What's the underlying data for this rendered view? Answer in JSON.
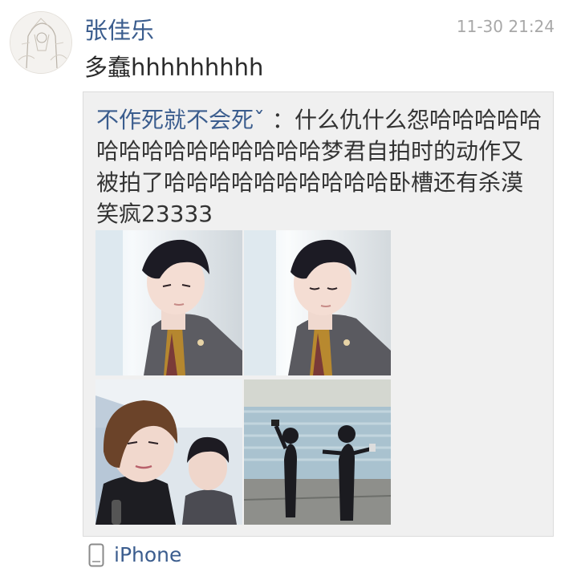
{
  "post": {
    "author": "张佳乐",
    "timestamp": "11-30 21:24",
    "text": "多蠢hhhhhhhhh",
    "source": "iPhone"
  },
  "repost": {
    "author": "不作死就不会死ˇ",
    "separator": "：",
    "text": "什么仇什么怨哈哈哈哈哈哈哈哈哈哈哈哈哈哈哈梦君自拍时的动作又被拍了哈哈哈哈哈哈哈哈哈哈卧槽还有杀漠 笑疯23333"
  },
  "icons": {
    "device": "phone-icon"
  },
  "colors": {
    "link": "#3b5d8e",
    "text": "#2b2b2b",
    "muted": "#a8a8a8",
    "repost_bg": "#f0f0f0"
  }
}
